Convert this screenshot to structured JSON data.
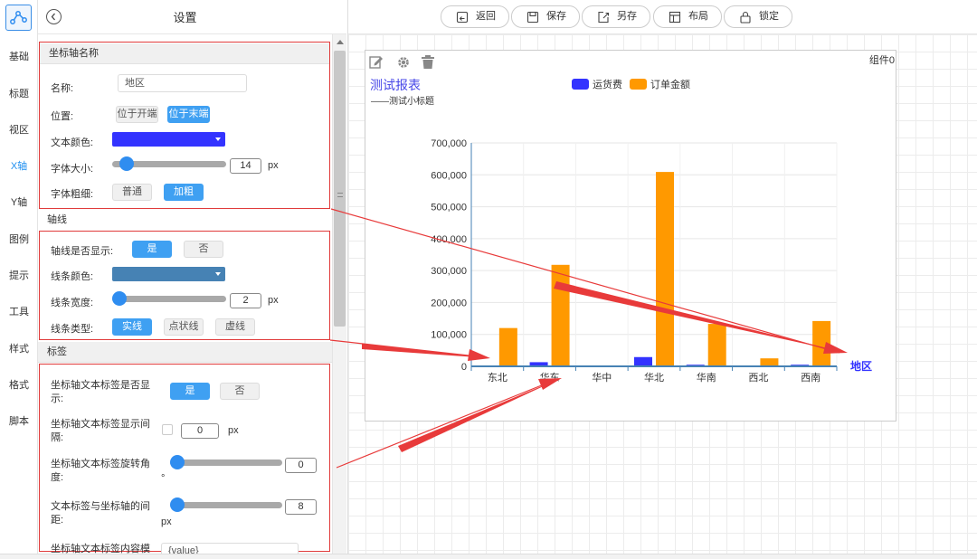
{
  "nav": {
    "items": [
      "基础",
      "标题",
      "视区",
      "X轴",
      "Y轴",
      "图例",
      "提示",
      "工具",
      "样式",
      "格式",
      "脚本"
    ],
    "active_index": 3,
    "accent": "#1e8ff0"
  },
  "panel": {
    "title": "设置",
    "axis_name": {
      "header": "坐标轴名称",
      "name_label": "名称:",
      "name_value": "地区",
      "position_label": "位置:",
      "position_options": [
        "位于开端",
        "位于末端"
      ],
      "position_selected": 1,
      "color_label": "文本颜色:",
      "color": "#3333ff",
      "fontsize_label": "字体大小:",
      "fontsize_value": "14",
      "fontsize_unit": "px",
      "weight_label": "字体粗细:",
      "weight_options": [
        "普通",
        "加粗"
      ],
      "weight_selected": 1
    },
    "axis_line": {
      "header": "轴线",
      "show_label": "轴线是否显示:",
      "show_options": [
        "是",
        "否"
      ],
      "show_selected": 0,
      "color_label": "线条颜色:",
      "color": "#4682b4",
      "width_label": "线条宽度:",
      "width_value": "2",
      "width_unit": "px",
      "type_label": "线条类型:",
      "type_options": [
        "实线",
        "点状线",
        "虚线"
      ],
      "type_selected": 0
    },
    "axis_label": {
      "header": "标签",
      "show_label": "坐标轴文本标签是否显示:",
      "show_options": [
        "是",
        "否"
      ],
      "show_selected": 0,
      "interval_label": "坐标轴文本标签显示间隔:",
      "interval_value": "0",
      "interval_unit": "px",
      "rotate_label": "坐标轴文本标签旋转角度:",
      "rotate_value": "0",
      "rotate_unit": "°",
      "margin_label": "文本标签与坐标轴的间距:",
      "margin_value": "8",
      "margin_unit": "px",
      "formatter_label": "坐标轴文本标签内容模",
      "formatter_value": "{value}"
    }
  },
  "toolbar": {
    "buttons": [
      {
        "label": "返回",
        "icon": "back-icon"
      },
      {
        "label": "保存",
        "icon": "save-icon"
      },
      {
        "label": "另存",
        "icon": "save-as-icon"
      },
      {
        "label": "布局",
        "icon": "layout-icon"
      },
      {
        "label": "锁定",
        "icon": "lock-icon"
      }
    ]
  },
  "component": {
    "id": "组件0",
    "icons": [
      "edit-icon",
      "gear-icon",
      "trash-icon"
    ]
  },
  "chart_data": {
    "type": "bar",
    "title": "测试报表",
    "subtitle": "——测试小标题",
    "xlabel": "地区",
    "ylabel": "",
    "categories": [
      "东北",
      "华东",
      "华中",
      "华北",
      "华南",
      "西北",
      "西南"
    ],
    "series": [
      {
        "name": "运货费",
        "color": "#3333ff",
        "values": [
          2500,
          13000,
          500,
          29000,
          5000,
          1500,
          5000
        ]
      },
      {
        "name": "订单金额",
        "color": "#ff9900",
        "values": [
          120000,
          318000,
          1000,
          609000,
          133000,
          25000,
          142000
        ]
      }
    ],
    "ylim": [
      0,
      700000
    ],
    "yticks": [
      "0",
      "100,000",
      "200,000",
      "300,000",
      "400,000",
      "500,000",
      "600,000",
      "700,000"
    ],
    "grid": true,
    "legend_position": "top-center"
  }
}
